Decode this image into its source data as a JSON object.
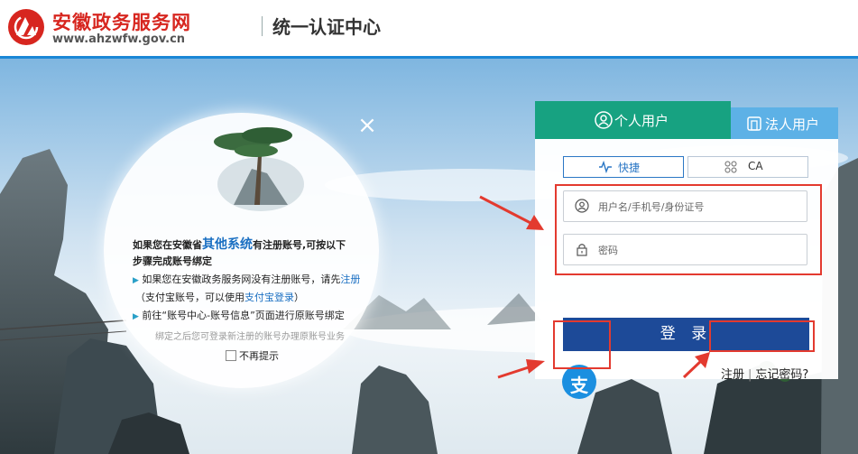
{
  "header": {
    "site_name": "安徽政务服务网",
    "site_url": "www.ahzwfw.gov.cn",
    "center_title": "统一认证中心"
  },
  "popup": {
    "line1_a": "如果您在安徽省",
    "line1_highlight": "其他系统",
    "line1_b": "有注册账号,可按以下",
    "line2": "步骤完成账号绑定",
    "line3_a": "如果您在安徽政务服务网没有注册账号，请先",
    "line3_link": "注册",
    "line4_a": "（支付宝账号，可以使用",
    "line4_link": "支付宝登录",
    "line4_b": "）",
    "line5": "前往“账号中心-账号信息”页面进行原账号绑定",
    "line6": "绑定之后您可登录新注册的账号办理原账号业务",
    "no_remind": "不再提示",
    "close": "×"
  },
  "login": {
    "tab_personal": "个人用户",
    "tab_corporate": "法人用户",
    "mode_quick": "快捷",
    "mode_ca": "CA",
    "username_placeholder": "用户名/手机号/身份证号",
    "password_placeholder": "密码",
    "login_button": "登 录",
    "register_link": "注册",
    "forgot_link": "忘记密码?",
    "alipay_glyph": "支"
  },
  "colors": {
    "brand_red": "#d7261f",
    "tab_green": "#17a281",
    "tab_blue": "#5db1e6",
    "login_blue": "#1d4a98",
    "annotation_red": "#e33a2f"
  }
}
